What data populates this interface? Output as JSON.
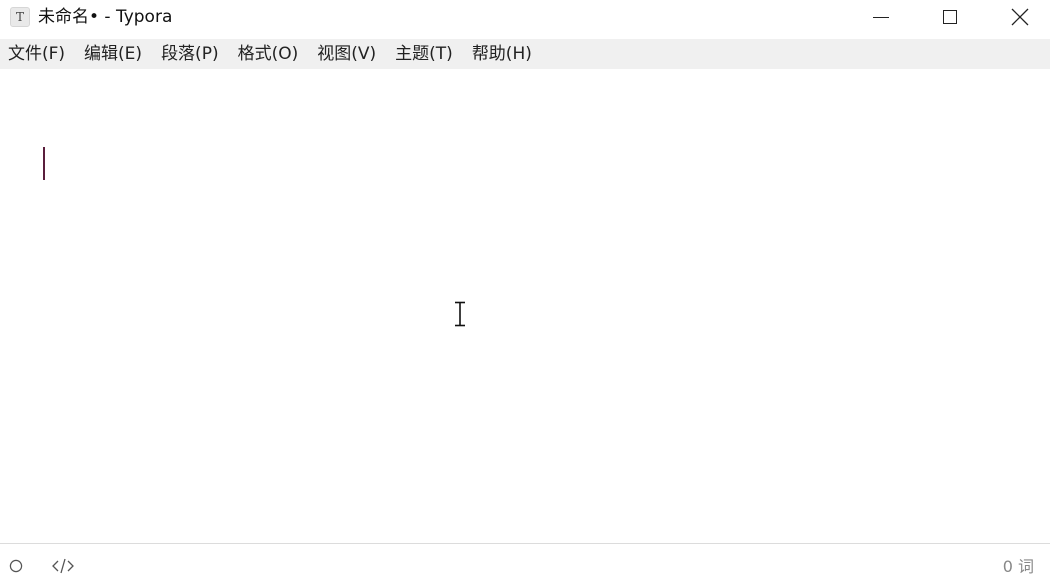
{
  "window": {
    "title": "未命名• - Typora",
    "app_icon_letter": "T"
  },
  "menu": {
    "items": [
      {
        "label": "文件(F)"
      },
      {
        "label": "编辑(E)"
      },
      {
        "label": "段落(P)"
      },
      {
        "label": "格式(O)"
      },
      {
        "label": "视图(V)"
      },
      {
        "label": "主题(T)"
      },
      {
        "label": "帮助(H)"
      }
    ]
  },
  "status": {
    "word_count": "0 词"
  },
  "colors": {
    "menubar_bg": "#f0f0f0",
    "caret": "#5a1e3c",
    "status_text": "#888888"
  },
  "icons": {
    "outline_toggle": "circle-outline-icon",
    "source_mode": "code-brackets-icon",
    "minimize": "minimize-icon",
    "maximize": "maximize-icon",
    "close": "close-icon",
    "app": "typora-app-icon"
  }
}
